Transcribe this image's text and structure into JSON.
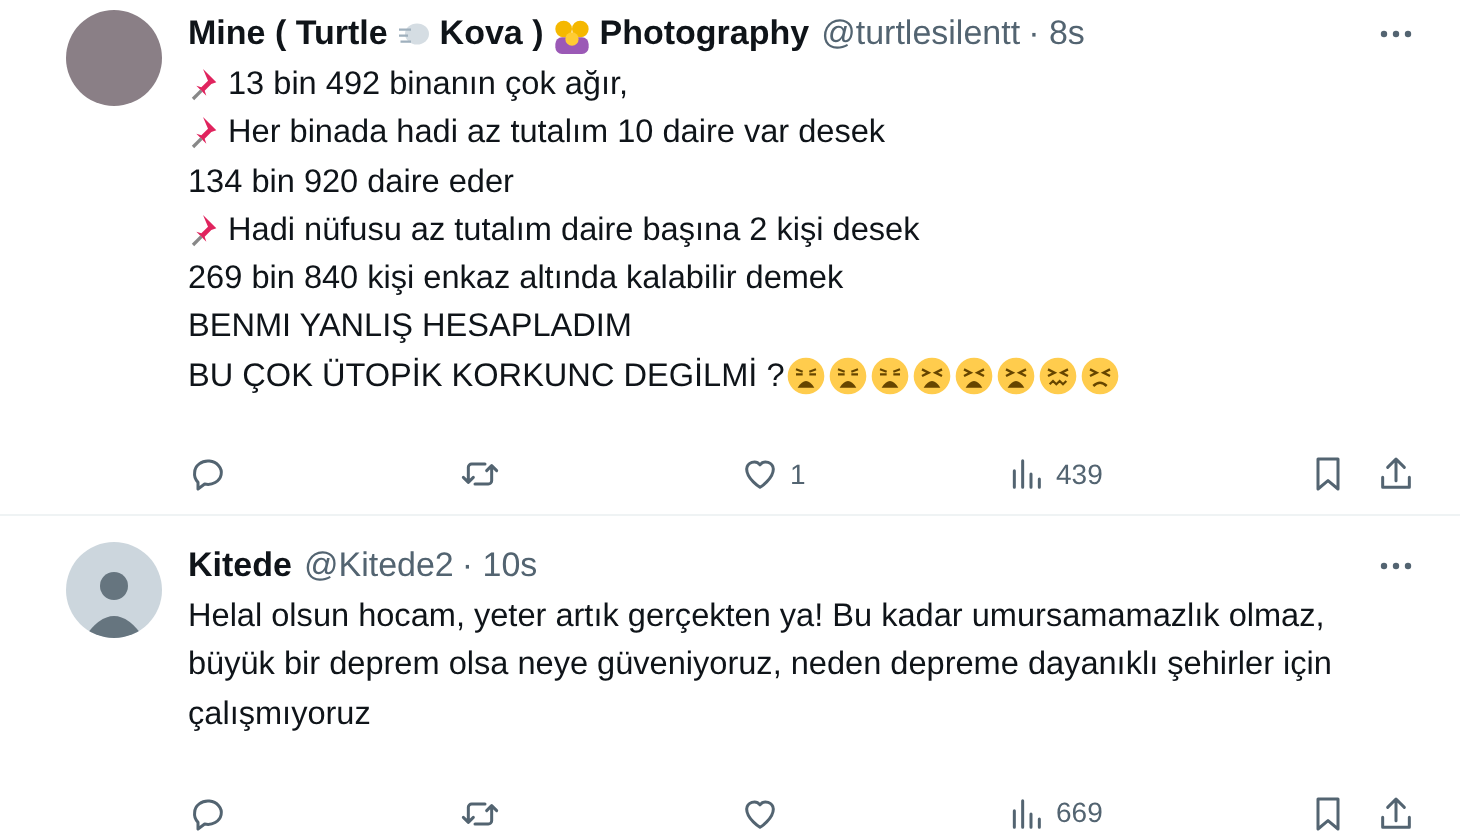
{
  "tweets": [
    {
      "name_parts": [
        {
          "kind": "text",
          "text": "Mine ( Turtle"
        },
        {
          "kind": "wind"
        },
        {
          "kind": "text",
          "text": "Kova )"
        },
        {
          "kind": "family"
        },
        {
          "kind": "text",
          "text": "Photography"
        }
      ],
      "handle": "@turtlesilentt",
      "time": "· 8s",
      "avatar": {
        "kind": "photo"
      },
      "lines": [
        {
          "kind": "pinned",
          "text": "13 bin 492 binanın çok ağır,"
        },
        {
          "kind": "pinned",
          "text": "Her binada hadi az tutalım 10 daire var desek"
        },
        {
          "kind": "plain",
          "text": "134 bin 920 daire eder"
        },
        {
          "kind": "pinned",
          "text": "Hadi nüfusu az tutalım daire başına 2 kişi desek"
        },
        {
          "kind": "plain",
          "text": "269 bin 840 kişi enkaz altında kalabilir demek"
        },
        {
          "kind": "plain",
          "text": "BENMI YANLIŞ HESAPLADIM"
        },
        {
          "kind": "faces",
          "text": "BU ÇOK ÜTOPİK KORKUNC DEGİLMİ ?"
        }
      ],
      "likes": "1",
      "views": "439"
    },
    {
      "name_parts": [
        {
          "kind": "text",
          "text": "Kitede"
        }
      ],
      "handle": "@Kitede2",
      "time": "· 10s",
      "avatar": {
        "kind": "default"
      },
      "lines": [
        {
          "kind": "paragraph",
          "text": "Helal olsun hocam, yeter artık gerçekten ya! Bu kadar umursamamazlık olmaz, büyük bir deprem olsa neye güveniyoruz, neden depreme dayanıklı şehirler için çalışmıyoruz"
        }
      ],
      "views": "669"
    }
  ]
}
